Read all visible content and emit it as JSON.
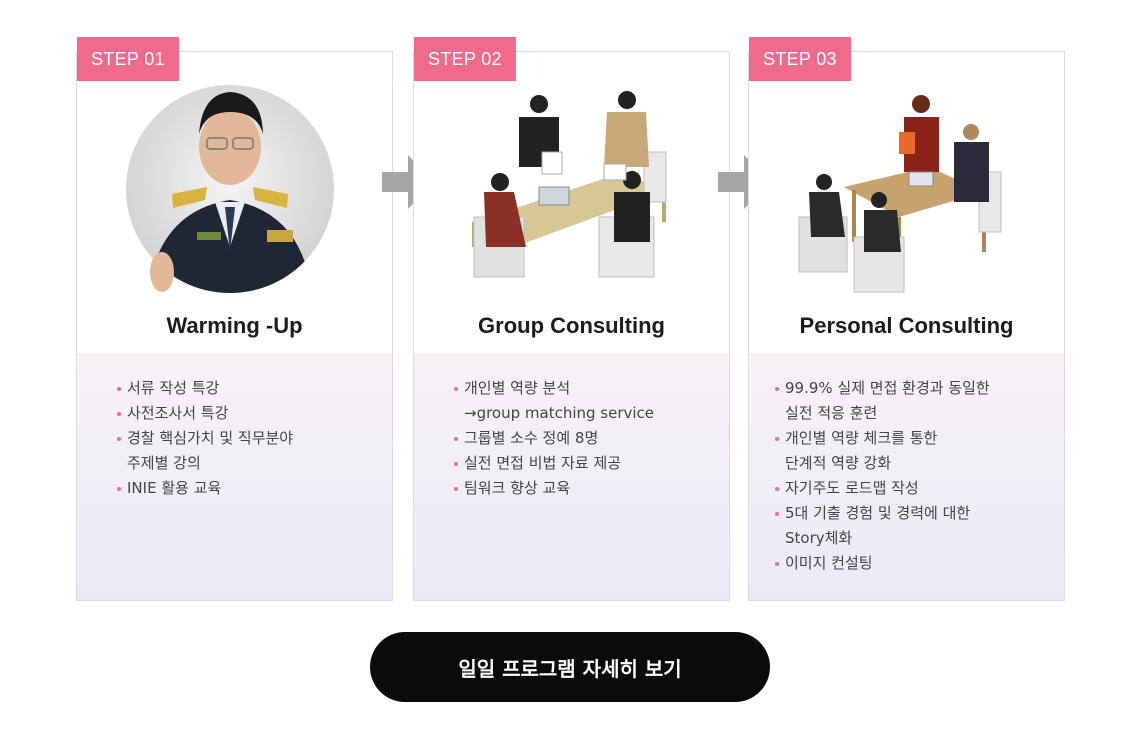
{
  "steps": [
    {
      "badge": "STEP 01",
      "title": "Warming -Up",
      "items": [
        {
          "l1": "서류 작성 특강",
          "l2": ""
        },
        {
          "l1": "사전조사서 특강",
          "l2": ""
        },
        {
          "l1": "경찰 핵심가치 및 직무분야",
          "l2": "주제별 강의"
        },
        {
          "l1": "INIE 활용 교육",
          "l2": ""
        }
      ]
    },
    {
      "badge": "STEP 02",
      "title": "Group Consulting",
      "items": [
        {
          "l1": "개인별 역량 분석",
          "l2": "→group matching service"
        },
        {
          "l1": "그룹별 소수 정예 8명",
          "l2": ""
        },
        {
          "l1": "실전 면접 비법 자료 제공",
          "l2": ""
        },
        {
          "l1": "팀워크 향상 교육",
          "l2": ""
        }
      ]
    },
    {
      "badge": "STEP 03",
      "title": "Personal Consulting",
      "items": [
        {
          "l1": "99.9% 실제 면접 환경과 동일한",
          "l2": "실전 적응 훈련"
        },
        {
          "l1": "개인별 역량 체크를 통한",
          "l2": "단계적 역량 강화"
        },
        {
          "l1": "자기주도 로드맵 작성",
          "l2": ""
        },
        {
          "l1": "5대 기출 경험 및 경력에 대한",
          "l2": "Story체화"
        },
        {
          "l1": "이미지 컨설팅",
          "l2": ""
        }
      ]
    }
  ],
  "cta": {
    "label": "일일 프로그램 자세히 보기"
  },
  "colors": {
    "badge": "#f06a8c",
    "cta_bg": "#0b0b0b",
    "arrow": "#a6a6a6"
  }
}
